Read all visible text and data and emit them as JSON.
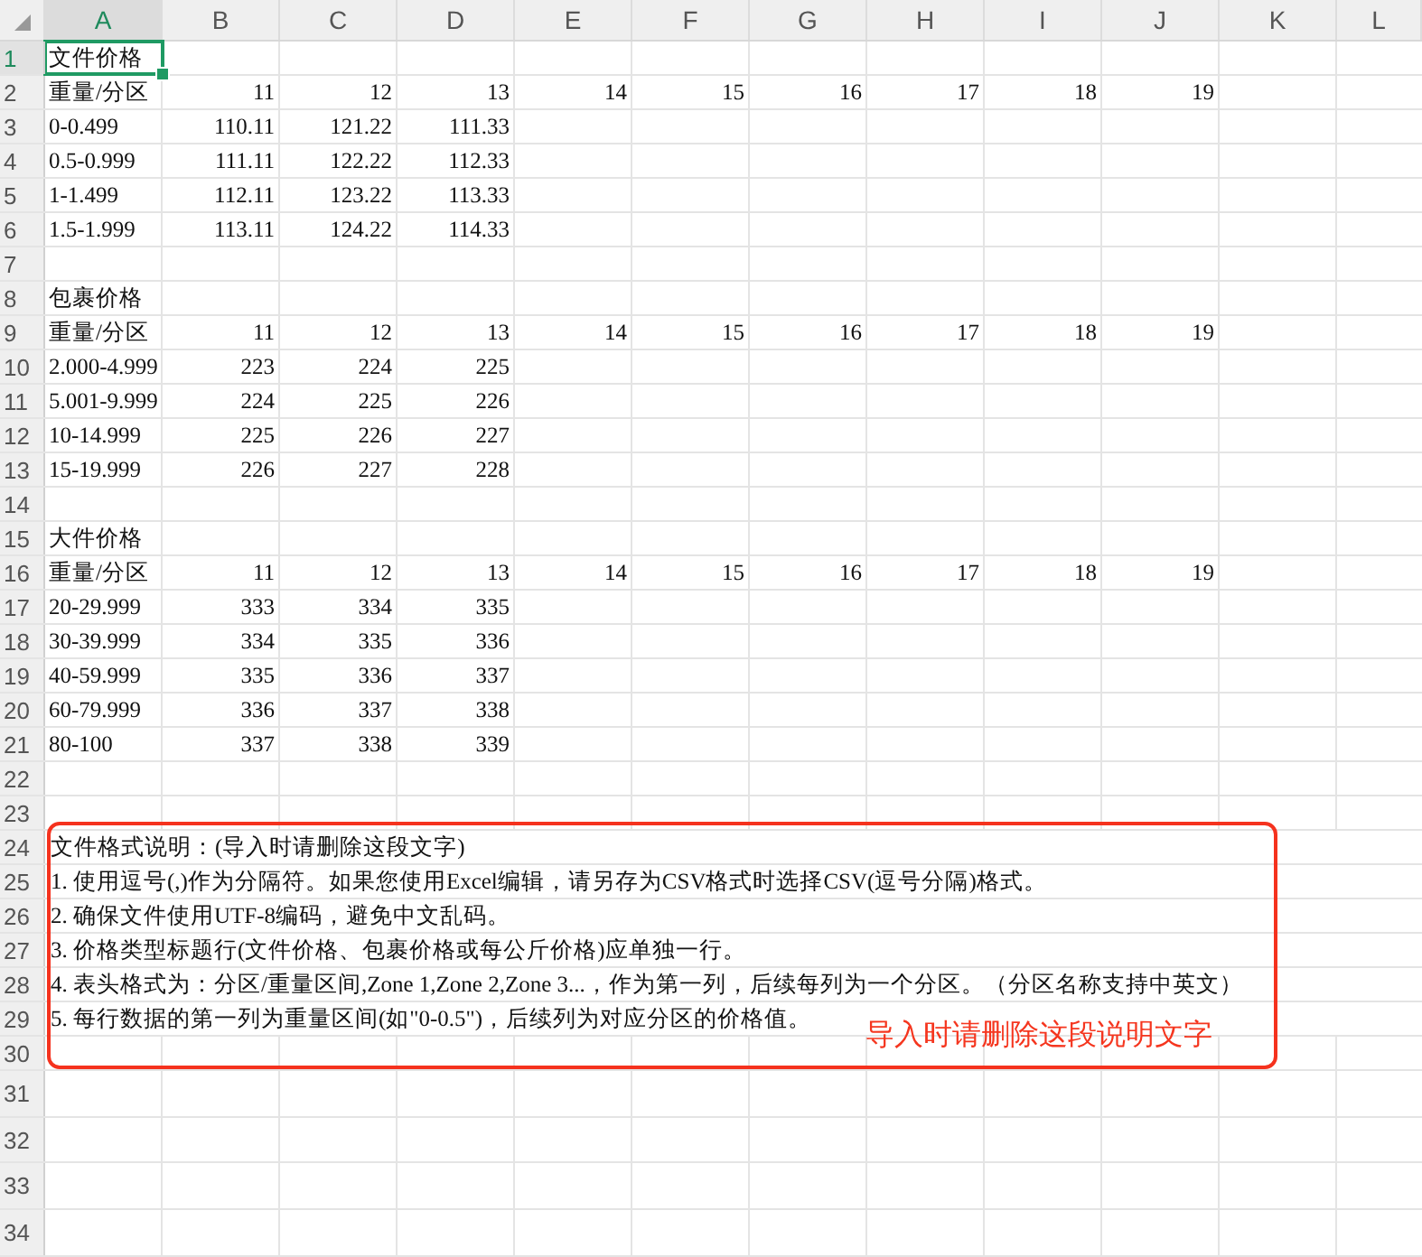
{
  "columns": [
    {
      "label": "A"
    },
    {
      "label": "B"
    },
    {
      "label": "C"
    },
    {
      "label": "D"
    },
    {
      "label": "E"
    },
    {
      "label": "F"
    },
    {
      "label": "G"
    },
    {
      "label": "H"
    },
    {
      "label": "I"
    },
    {
      "label": "J"
    },
    {
      "label": "K"
    },
    {
      "label": "L"
    }
  ],
  "rows": [
    {
      "label": "1",
      "cells": [
        {
          "kind": "text",
          "text": "文件价格",
          "selected": true
        }
      ]
    },
    {
      "label": "2",
      "cells": [
        {
          "kind": "text",
          "text": "重量/分区",
          "selected": false
        },
        {
          "kind": "number",
          "text": "11",
          "selected": false
        },
        {
          "kind": "number",
          "text": "12",
          "selected": false
        },
        {
          "kind": "number",
          "text": "13",
          "selected": false
        },
        {
          "kind": "number",
          "text": "14",
          "selected": false
        },
        {
          "kind": "number",
          "text": "15",
          "selected": false
        },
        {
          "kind": "number",
          "text": "16",
          "selected": false
        },
        {
          "kind": "number",
          "text": "17",
          "selected": false
        },
        {
          "kind": "number",
          "text": "18",
          "selected": false
        },
        {
          "kind": "number",
          "text": "19",
          "selected": false
        }
      ]
    },
    {
      "label": "3",
      "cells": [
        {
          "kind": "text",
          "text": "0-0.499",
          "selected": false
        },
        {
          "kind": "number",
          "text": "110.11",
          "selected": false
        },
        {
          "kind": "number",
          "text": "121.22",
          "selected": false
        },
        {
          "kind": "number",
          "text": "111.33",
          "selected": false
        }
      ]
    },
    {
      "label": "4",
      "cells": [
        {
          "kind": "text",
          "text": "0.5-0.999",
          "selected": false
        },
        {
          "kind": "number",
          "text": "111.11",
          "selected": false
        },
        {
          "kind": "number",
          "text": "122.22",
          "selected": false
        },
        {
          "kind": "number",
          "text": "112.33",
          "selected": false
        }
      ]
    },
    {
      "label": "5",
      "cells": [
        {
          "kind": "text",
          "text": "1-1.499",
          "selected": false
        },
        {
          "kind": "number",
          "text": "112.11",
          "selected": false
        },
        {
          "kind": "number",
          "text": "123.22",
          "selected": false
        },
        {
          "kind": "number",
          "text": "113.33",
          "selected": false
        }
      ]
    },
    {
      "label": "6",
      "cells": [
        {
          "kind": "text",
          "text": "1.5-1.999",
          "selected": false
        },
        {
          "kind": "number",
          "text": "113.11",
          "selected": false
        },
        {
          "kind": "number",
          "text": "124.22",
          "selected": false
        },
        {
          "kind": "number",
          "text": "114.33",
          "selected": false
        }
      ]
    },
    {
      "label": "7"
    },
    {
      "label": "8",
      "cells": [
        {
          "kind": "text",
          "text": "包裹价格",
          "selected": false
        }
      ]
    },
    {
      "label": "9",
      "cells": [
        {
          "kind": "text",
          "text": "重量/分区",
          "selected": false
        },
        {
          "kind": "number",
          "text": "11",
          "selected": false
        },
        {
          "kind": "number",
          "text": "12",
          "selected": false
        },
        {
          "kind": "number",
          "text": "13",
          "selected": false
        },
        {
          "kind": "number",
          "text": "14",
          "selected": false
        },
        {
          "kind": "number",
          "text": "15",
          "selected": false
        },
        {
          "kind": "number",
          "text": "16",
          "selected": false
        },
        {
          "kind": "number",
          "text": "17",
          "selected": false
        },
        {
          "kind": "number",
          "text": "18",
          "selected": false
        },
        {
          "kind": "number",
          "text": "19",
          "selected": false
        }
      ]
    },
    {
      "label": "10",
      "cells": [
        {
          "kind": "text",
          "text": "2.000-4.999",
          "selected": false
        },
        {
          "kind": "number",
          "text": "223",
          "selected": false
        },
        {
          "kind": "number",
          "text": "224",
          "selected": false
        },
        {
          "kind": "number",
          "text": "225",
          "selected": false
        }
      ]
    },
    {
      "label": "11",
      "cells": [
        {
          "kind": "text",
          "text": "5.001-9.999",
          "selected": false
        },
        {
          "kind": "number",
          "text": "224",
          "selected": false
        },
        {
          "kind": "number",
          "text": "225",
          "selected": false
        },
        {
          "kind": "number",
          "text": "226",
          "selected": false
        }
      ]
    },
    {
      "label": "12",
      "cells": [
        {
          "kind": "text",
          "text": "10-14.999",
          "selected": false
        },
        {
          "kind": "number",
          "text": "225",
          "selected": false
        },
        {
          "kind": "number",
          "text": "226",
          "selected": false
        },
        {
          "kind": "number",
          "text": "227",
          "selected": false
        }
      ]
    },
    {
      "label": "13",
      "cells": [
        {
          "kind": "text",
          "text": "15-19.999",
          "selected": false
        },
        {
          "kind": "number",
          "text": "226",
          "selected": false
        },
        {
          "kind": "number",
          "text": "227",
          "selected": false
        },
        {
          "kind": "number",
          "text": "228",
          "selected": false
        }
      ]
    },
    {
      "label": "14"
    },
    {
      "label": "15",
      "cells": [
        {
          "kind": "text",
          "text": "大件价格",
          "selected": false
        }
      ]
    },
    {
      "label": "16",
      "cells": [
        {
          "kind": "text",
          "text": "重量/分区",
          "selected": false
        },
        {
          "kind": "number",
          "text": "11",
          "selected": false
        },
        {
          "kind": "number",
          "text": "12",
          "selected": false
        },
        {
          "kind": "number",
          "text": "13",
          "selected": false
        },
        {
          "kind": "number",
          "text": "14",
          "selected": false
        },
        {
          "kind": "number",
          "text": "15",
          "selected": false
        },
        {
          "kind": "number",
          "text": "16",
          "selected": false
        },
        {
          "kind": "number",
          "text": "17",
          "selected": false
        },
        {
          "kind": "number",
          "text": "18",
          "selected": false
        },
        {
          "kind": "number",
          "text": "19",
          "selected": false
        }
      ]
    },
    {
      "label": "17",
      "cells": [
        {
          "kind": "text",
          "text": "20-29.999",
          "selected": false
        },
        {
          "kind": "number",
          "text": "333",
          "selected": false
        },
        {
          "kind": "number",
          "text": "334",
          "selected": false
        },
        {
          "kind": "number",
          "text": "335",
          "selected": false
        }
      ]
    },
    {
      "label": "18",
      "cells": [
        {
          "kind": "text",
          "text": "30-39.999",
          "selected": false
        },
        {
          "kind": "number",
          "text": "334",
          "selected": false
        },
        {
          "kind": "number",
          "text": "335",
          "selected": false
        },
        {
          "kind": "number",
          "text": "336",
          "selected": false
        }
      ]
    },
    {
      "label": "19",
      "cells": [
        {
          "kind": "text",
          "text": "40-59.999",
          "selected": false
        },
        {
          "kind": "number",
          "text": "335",
          "selected": false
        },
        {
          "kind": "number",
          "text": "336",
          "selected": false
        },
        {
          "kind": "number",
          "text": "337",
          "selected": false
        }
      ]
    },
    {
      "label": "20",
      "cells": [
        {
          "kind": "text",
          "text": "60-79.999",
          "selected": false
        },
        {
          "kind": "number",
          "text": "336",
          "selected": false
        },
        {
          "kind": "number",
          "text": "337",
          "selected": false
        },
        {
          "kind": "number",
          "text": "338",
          "selected": false
        }
      ]
    },
    {
      "label": "21",
      "cells": [
        {
          "kind": "text",
          "text": "80-100",
          "selected": false
        },
        {
          "kind": "number",
          "text": "337",
          "selected": false
        },
        {
          "kind": "number",
          "text": "338",
          "selected": false
        },
        {
          "kind": "number",
          "text": "339",
          "selected": false
        }
      ]
    },
    {
      "label": "22"
    },
    {
      "label": "23"
    },
    {
      "label": "24",
      "cells": [
        {
          "kind": "note",
          "text": "文件格式说明：(导入时请删除这段文字)",
          "selected": false
        }
      ]
    },
    {
      "label": "25",
      "cells": [
        {
          "kind": "note",
          "text": "1. 使用逗号(,)作为分隔符。如果您使用Excel编辑，请另存为CSV格式时选择CSV(逗号分隔)格式。",
          "selected": false
        }
      ]
    },
    {
      "label": "26",
      "cells": [
        {
          "kind": "note",
          "text": "2. 确保文件使用UTF-8编码，避免中文乱码。",
          "selected": false
        }
      ]
    },
    {
      "label": "27",
      "cells": [
        {
          "kind": "note",
          "text": "3. 价格类型标题行(文件价格、包裹价格或每公斤价格)应单独一行。",
          "selected": false
        }
      ]
    },
    {
      "label": "28",
      "cells": [
        {
          "kind": "note",
          "text": "4. 表头格式为：分区/重量区间,Zone 1,Zone 2,Zone 3...，作为第一列，后续每列为一个分区。（分区名称支持中英文）",
          "selected": false
        }
      ]
    },
    {
      "label": "29",
      "cells": [
        {
          "kind": "note",
          "text": "5. 每行数据的第一列为重量区间(如\"0-0.5\")，后续列为对应分区的价格值。",
          "selected": false
        }
      ]
    },
    {
      "label": "30"
    },
    {
      "label": "31"
    },
    {
      "label": "32"
    },
    {
      "label": "33"
    },
    {
      "label": "34"
    }
  ],
  "annotation": {
    "text": "导入时请删除这段说明文字"
  }
}
